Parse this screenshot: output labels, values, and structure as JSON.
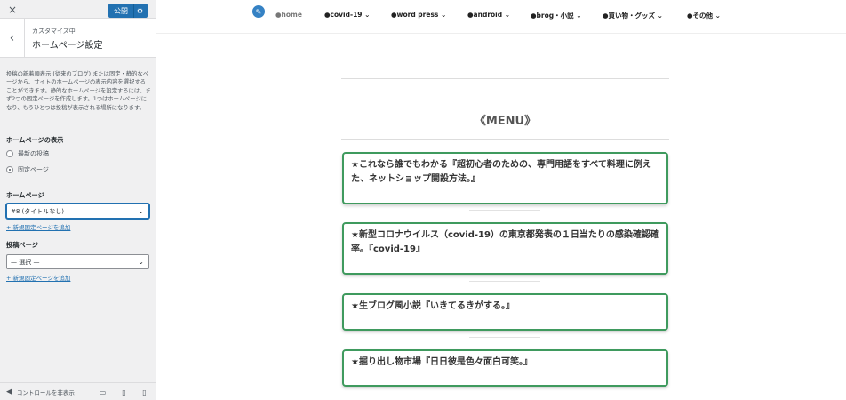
{
  "sidebar": {
    "close_icon": "×",
    "publish_label": "公開",
    "section_sub": "カスタマイズ中",
    "section_title": "ホームページ設定",
    "description": "投稿の新着順表示 (従来のブログ) または固定・静的なページから、サイトのホームページの表示内容を選択することができます。静的なホームページを設定するには、まず2つの固定ページを作成します。1つはホームページになり、もうひとつは投稿が表示される場所になります。",
    "homepage_display_label": "ホームページの表示",
    "radio_latest": "最新の投稿",
    "radio_static": "固定ページ",
    "homepage_label": "ホームページ",
    "homepage_select": "#8 (タイトルなし)",
    "add_page_link_1": "+ 新規固定ページを追加",
    "posts_page_label": "投稿ページ",
    "posts_select": "— 選択 —",
    "add_page_link_2": "+ 新規固定ページを追加",
    "hide_controls": "コントロールを非表示"
  },
  "nav": {
    "items": [
      {
        "label": "●home"
      },
      {
        "label": "●covid-19 ⌄"
      },
      {
        "label": "●word press ⌄"
      },
      {
        "label": "●android ⌄"
      },
      {
        "label": "●brog・小説 ⌄"
      },
      {
        "label": "●買い物・グッズ ⌄"
      },
      {
        "label": "●その他 ⌄"
      }
    ]
  },
  "main": {
    "menu_title": "《MENU》",
    "cards": [
      {
        "text": "★これなら誰でもわかる『超初心者のための、専門用語をすべて料理に例えた、ネットショップ開設方法。』"
      },
      {
        "text": "★新型コロナウイルス（covid-19）の東京都発表の１日当たりの感染確認確率。『covid-19』"
      },
      {
        "text": "★生ブログ風小説『いきてるきがする。』"
      },
      {
        "text": "★掘り出し物市場『日日彼是色々面白可笑。』"
      }
    ]
  },
  "colors": {
    "accent": "#2271b1",
    "card_border": "#3f9a5e"
  }
}
